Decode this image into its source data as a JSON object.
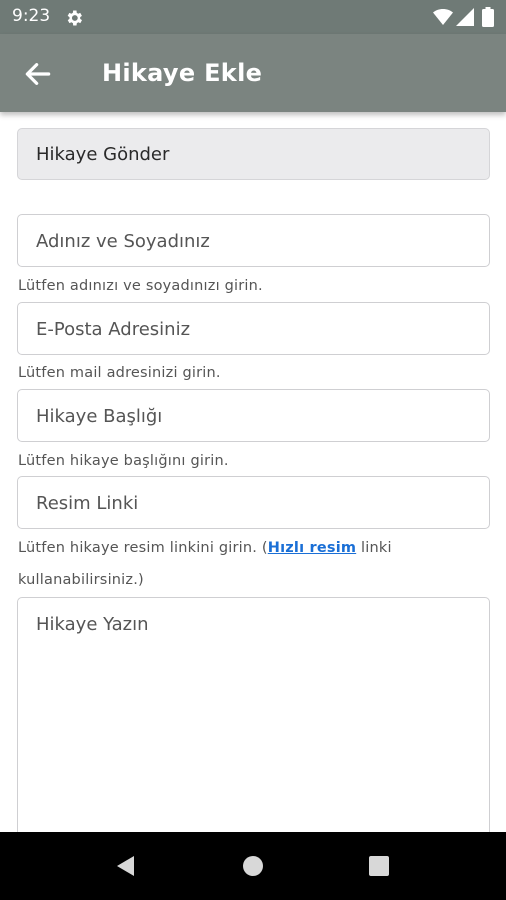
{
  "status_bar": {
    "time": "9:23",
    "icons": [
      "gear-icon",
      "wifi-icon",
      "signal-icon",
      "battery-icon"
    ]
  },
  "app_bar": {
    "title": "Hikaye Ekle",
    "back_icon": "arrow-left-icon"
  },
  "form": {
    "submit_label": "Hikaye Gönder",
    "name_placeholder": "Adınız ve Soyadınız",
    "name_hint": "Lütfen adınızı ve soyadınızı girin.",
    "email_placeholder": "E-Posta Adresiniz",
    "email_hint": "Lütfen mail adresinizi girin.",
    "title_placeholder": "Hikaye Başlığı",
    "title_hint": "Lütfen hikaye başlığını girin.",
    "image_placeholder": "Resim Linki",
    "image_hint_prefix": "Lütfen hikaye resim linkini girin. (",
    "image_hint_link": "Hızlı resim",
    "image_hint_suffix": " linki",
    "image_hint_line2": "kullanabilirsiniz.)",
    "story_placeholder": "Hikaye Yazın"
  },
  "nav_bar": {
    "icons": [
      "back-triangle-icon",
      "home-circle-icon",
      "recents-square-icon"
    ]
  },
  "colors": {
    "app_bar": "#7b8480",
    "status_bar": "#6f7a76",
    "link": "#1a6fd6"
  }
}
